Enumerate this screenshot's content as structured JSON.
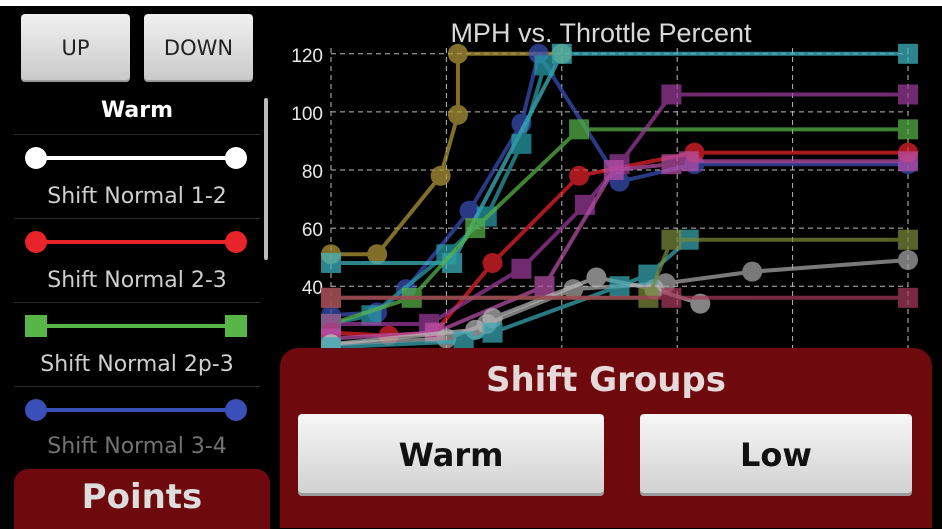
{
  "nav": {
    "up_label": "UP",
    "down_label": "DOWN"
  },
  "legend": {
    "group_title": "Warm",
    "items": [
      {
        "label": "Shift Normal 1-2",
        "color": "#ffffff",
        "marker": "circle"
      },
      {
        "label": "Shift Normal 2-3",
        "color": "#e8232a",
        "marker": "circle"
      },
      {
        "label": "Shift Normal 2p-3",
        "color": "#58b548",
        "marker": "square"
      },
      {
        "label": "Shift Normal 3-4",
        "color": "#3b4fb8",
        "marker": "circle"
      }
    ]
  },
  "points_panel": {
    "title": "Points"
  },
  "shift_groups": {
    "title": "Shift Groups",
    "buttons": [
      "Warm",
      "Low"
    ]
  },
  "chart_data": {
    "type": "line",
    "title": "MPH vs. Throttle Percent",
    "xlabel": "",
    "ylabel": "",
    "x_ticks": [],
    "y_ticks": [
      40,
      60,
      80,
      100,
      120
    ],
    "xlim": [
      0,
      100
    ],
    "ylim": [
      17,
      122
    ],
    "grid": true,
    "series": [
      {
        "color": "#b39a3a",
        "marker": "circle",
        "x": [
          0,
          8,
          19,
          22,
          22,
          40
        ],
        "y": [
          51,
          51,
          78,
          99,
          120,
          120
        ]
      },
      {
        "color": "#3b4fb8",
        "marker": "circle",
        "x": [
          0,
          8,
          13,
          24,
          33,
          36,
          50,
          63,
          100
        ],
        "y": [
          30,
          31,
          39,
          66,
          96,
          120,
          76,
          82,
          82
        ]
      },
      {
        "color": "#3fb8c4",
        "marker": "square",
        "x": [
          0,
          21,
          40,
          100
        ],
        "y": [
          48,
          48,
          120,
          120
        ]
      },
      {
        "color": "#2a9ea8",
        "marker": "square",
        "x": [
          0,
          7,
          20,
          27,
          33,
          37
        ],
        "y": [
          27,
          30,
          51,
          64,
          89,
          116
        ]
      },
      {
        "color": "#58b548",
        "marker": "square",
        "x": [
          0,
          14,
          25,
          43,
          100
        ],
        "y": [
          27,
          36,
          60,
          94,
          94
        ]
      },
      {
        "color": "#e8232a",
        "marker": "circle",
        "x": [
          0,
          10,
          18,
          28,
          43,
          63,
          100
        ],
        "y": [
          24,
          23,
          24,
          48,
          78,
          86,
          86
        ]
      },
      {
        "color": "#9c3b9c",
        "marker": "square",
        "x": [
          0,
          17,
          33,
          44,
          50,
          59,
          100
        ],
        "y": [
          27,
          27,
          46,
          68,
          82,
          106,
          106
        ]
      },
      {
        "color": "#b84fa8",
        "marker": "square",
        "x": [
          0,
          18,
          37,
          49,
          59,
          62,
          100
        ],
        "y": [
          22,
          24,
          40,
          80,
          82,
          83,
          83
        ]
      },
      {
        "color": "#a8a8a8",
        "marker": "circle",
        "x": [
          0,
          20,
          27,
          42,
          58,
          73,
          100
        ],
        "y": [
          20,
          22,
          27,
          39,
          41,
          45,
          49
        ]
      },
      {
        "color": "#b8b8b8",
        "marker": "circle",
        "x": [
          0,
          25,
          28,
          46,
          56,
          64
        ],
        "y": [
          20,
          25,
          29,
          43,
          39,
          34
        ]
      },
      {
        "color": "#3aa8b4",
        "marker": "square",
        "x": [
          0,
          23,
          28,
          50,
          55,
          62
        ],
        "y": [
          19,
          21,
          24,
          40,
          44,
          56
        ]
      },
      {
        "color": "#7a8a3a",
        "marker": "square",
        "x": [
          0,
          55,
          59,
          100
        ],
        "y": [
          36,
          36,
          56,
          56
        ]
      },
      {
        "color": "#a83a5a",
        "marker": "square",
        "x": [
          0,
          59,
          100
        ],
        "y": [
          36,
          36,
          36
        ]
      }
    ]
  }
}
